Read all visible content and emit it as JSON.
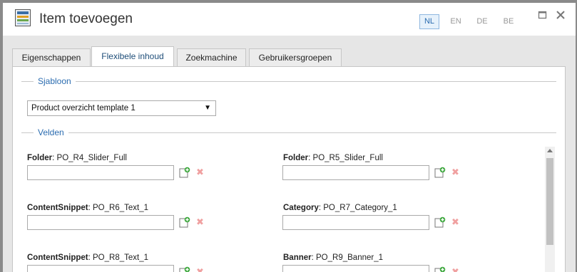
{
  "dialog": {
    "title": "Item toevoegen"
  },
  "languages": [
    {
      "code": "NL",
      "active": true
    },
    {
      "code": "EN",
      "active": false
    },
    {
      "code": "DE",
      "active": false
    },
    {
      "code": "BE",
      "active": false
    }
  ],
  "tabs": [
    {
      "label": "Eigenschappen",
      "active": false
    },
    {
      "label": "Flexibele inhoud",
      "active": true
    },
    {
      "label": "Zoekmachine",
      "active": false
    },
    {
      "label": "Gebruikersgroepen",
      "active": false
    }
  ],
  "template_section": {
    "legend": "Sjabloon",
    "selected": "Product overzicht template 1"
  },
  "fields_section": {
    "legend": "Velden",
    "fields": [
      {
        "type": "Folder",
        "name": "PO_R4_Slider_Full",
        "value": ""
      },
      {
        "type": "Folder",
        "name": "PO_R5_Slider_Full",
        "value": ""
      },
      {
        "type": "ContentSnippet",
        "name": "PO_R6_Text_1",
        "value": ""
      },
      {
        "type": "Category",
        "name": "PO_R7_Category_1",
        "value": ""
      },
      {
        "type": "ContentSnippet",
        "name": "PO_R8_Text_1",
        "value": ""
      },
      {
        "type": "Banner",
        "name": "PO_R9_Banner_1",
        "value": ""
      }
    ]
  },
  "colors": {
    "accent": "#2b6cb0",
    "active_lang_bg": "#e6f1fb",
    "delete_icon": "#f0a0a0",
    "add_icon": "#3aa63a"
  }
}
